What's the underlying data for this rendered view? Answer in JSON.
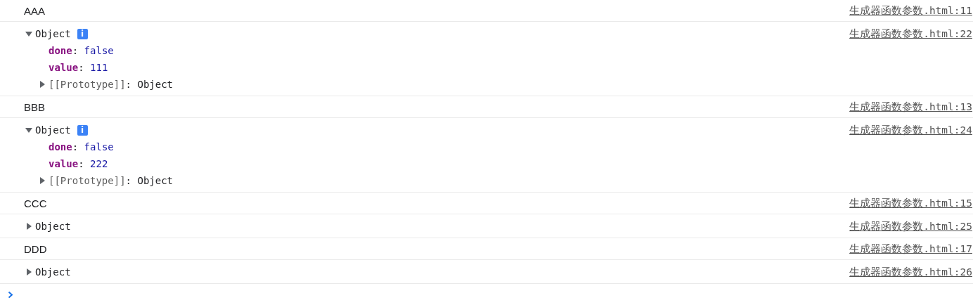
{
  "console": {
    "messages": [
      {
        "kind": "text",
        "text": "AAA",
        "source": "生成器函数参数.html:11"
      },
      {
        "kind": "object",
        "label": "Object",
        "expanded": true,
        "info_badge": "i",
        "source": "生成器函数参数.html:22",
        "properties": [
          {
            "kind": "own",
            "name": "done",
            "separator": ":",
            "value": "false"
          },
          {
            "kind": "own",
            "name": "value",
            "separator": ":",
            "value": "111"
          },
          {
            "kind": "internal",
            "name": "[[Prototype]]",
            "separator": ":",
            "value": "Object",
            "expanded": false
          }
        ]
      },
      {
        "kind": "text",
        "text": "BBB",
        "source": "生成器函数参数.html:13"
      },
      {
        "kind": "object",
        "label": "Object",
        "expanded": true,
        "info_badge": "i",
        "source": "生成器函数参数.html:24",
        "properties": [
          {
            "kind": "own",
            "name": "done",
            "separator": ":",
            "value": "false"
          },
          {
            "kind": "own",
            "name": "value",
            "separator": ":",
            "value": "222"
          },
          {
            "kind": "internal",
            "name": "[[Prototype]]",
            "separator": ":",
            "value": "Object",
            "expanded": false
          }
        ]
      },
      {
        "kind": "text",
        "text": "CCC",
        "source": "生成器函数参数.html:15"
      },
      {
        "kind": "object",
        "label": "Object",
        "expanded": false,
        "source": "生成器函数参数.html:25"
      },
      {
        "kind": "text",
        "text": "DDD",
        "source": "生成器函数参数.html:17"
      },
      {
        "kind": "object",
        "label": "Object",
        "expanded": false,
        "source": "生成器函数参数.html:26"
      }
    ]
  }
}
